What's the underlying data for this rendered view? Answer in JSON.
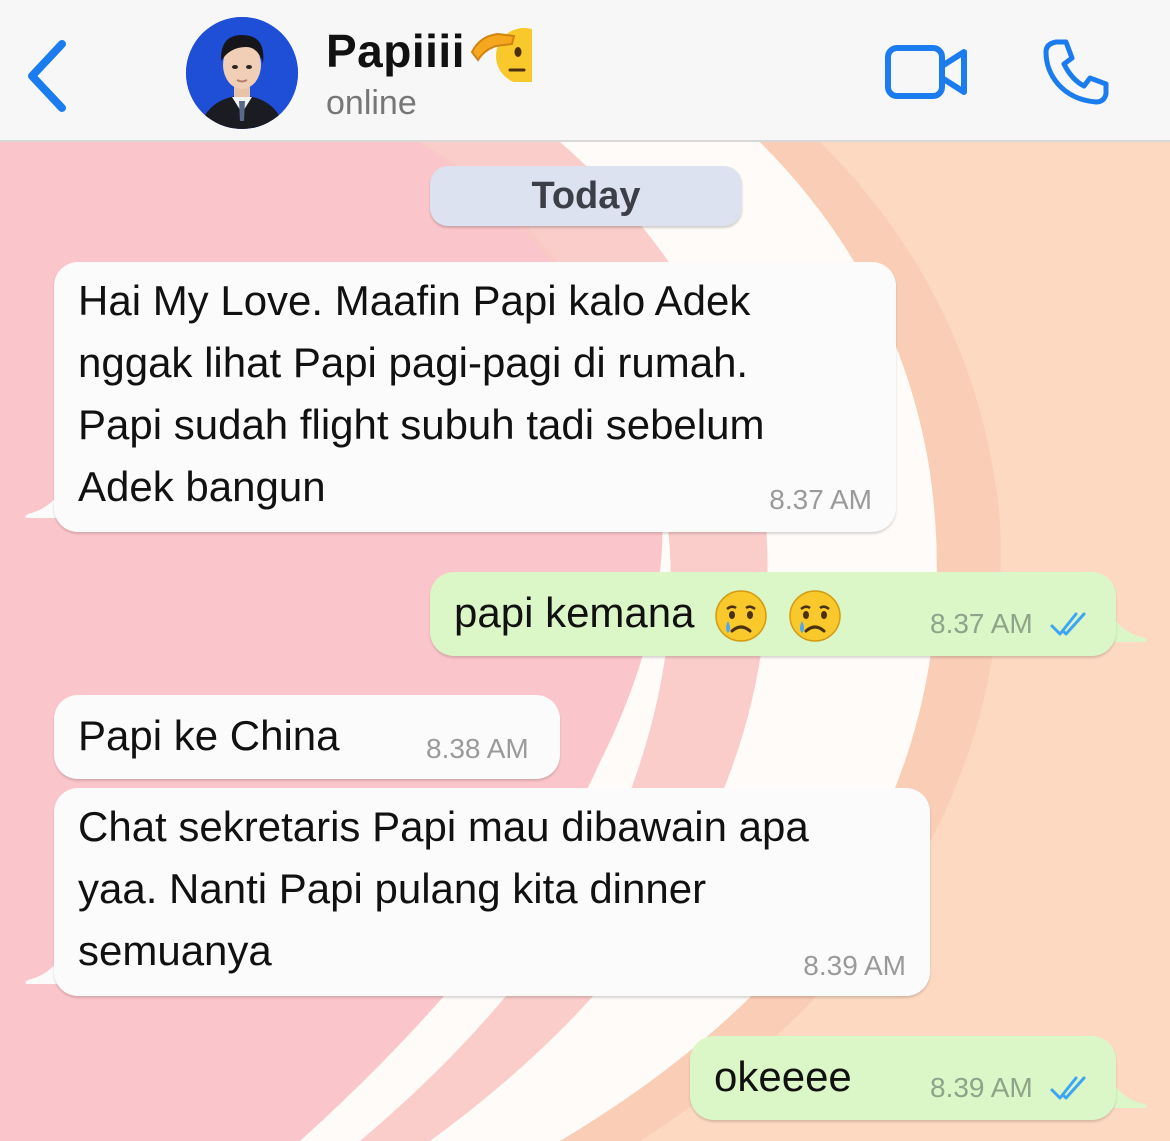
{
  "header": {
    "back_icon": "chevron-left-icon",
    "name": "Papiiii",
    "name_emoji": "saluting-face-emoji",
    "status": "online",
    "video_icon": "video-camera-icon",
    "call_icon": "phone-icon",
    "accent_color": "#1b7cf0"
  },
  "date_separator": "Today",
  "messages": [
    {
      "direction": "incoming",
      "lines": [
        "Hai My Love. Maafin Papi kalo Adek",
        "nggak lihat Papi pagi-pagi di rumah.",
        "Papi sudah flight subuh tadi sebelum",
        "Adek bangun"
      ],
      "time": "8.37 AM"
    },
    {
      "direction": "outgoing",
      "text": "papi kemana",
      "emojis": [
        "crying-face-emoji",
        "crying-face-emoji"
      ],
      "time": "8.37 AM",
      "status": "read"
    },
    {
      "direction": "incoming",
      "lines": [
        "Papi ke China"
      ],
      "time": "8.38 AM"
    },
    {
      "direction": "incoming",
      "lines": [
        "Chat sekretaris Papi mau dibawain apa",
        "yaa. Nanti Papi pulang kita dinner",
        "semuanya"
      ],
      "time": "8.39 AM"
    },
    {
      "direction": "outgoing",
      "text": "okeeee",
      "time": "8.39 AM",
      "status": "read"
    }
  ],
  "colors": {
    "incoming_bubble": "#fbfbfb",
    "outgoing_bubble": "#dbf7c7",
    "read_ticks": "#3da5f5",
    "wallpaper_pink": "#fbc6cb",
    "wallpaper_peach": "#fcd9c0"
  }
}
